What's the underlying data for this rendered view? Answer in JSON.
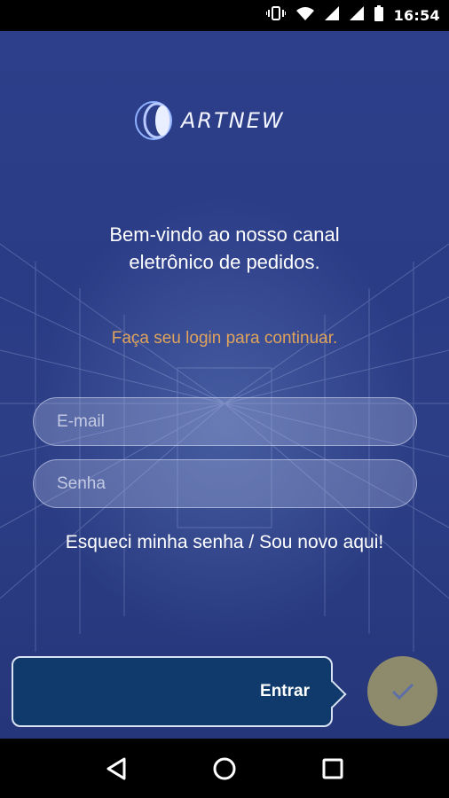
{
  "status_bar": {
    "time": "16:54",
    "icons": [
      "vibrate-icon",
      "wifi-icon",
      "signal-icon",
      "signal-icon",
      "battery-icon"
    ]
  },
  "logo": {
    "text": "ARTNEW"
  },
  "welcome": {
    "line1": "Bem-vindo ao nosso canal",
    "line2": "eletrônico de pedidos."
  },
  "subtitle": "Faça seu login para continuar.",
  "form": {
    "email_placeholder": "E-mail",
    "password_placeholder": "Senha"
  },
  "links": {
    "forgot_register": "Esqueci minha senha / Sou novo aqui!"
  },
  "actions": {
    "enter_label": "Entrar",
    "confirm_icon": "check-icon"
  },
  "nav_bar": {
    "icons": [
      "back-icon",
      "home-icon",
      "recents-icon"
    ]
  },
  "colors": {
    "background": "#2d3f8a",
    "accent": "#e0a35b",
    "button": "#0f3a6b",
    "confirm": "#8e8a6c"
  }
}
